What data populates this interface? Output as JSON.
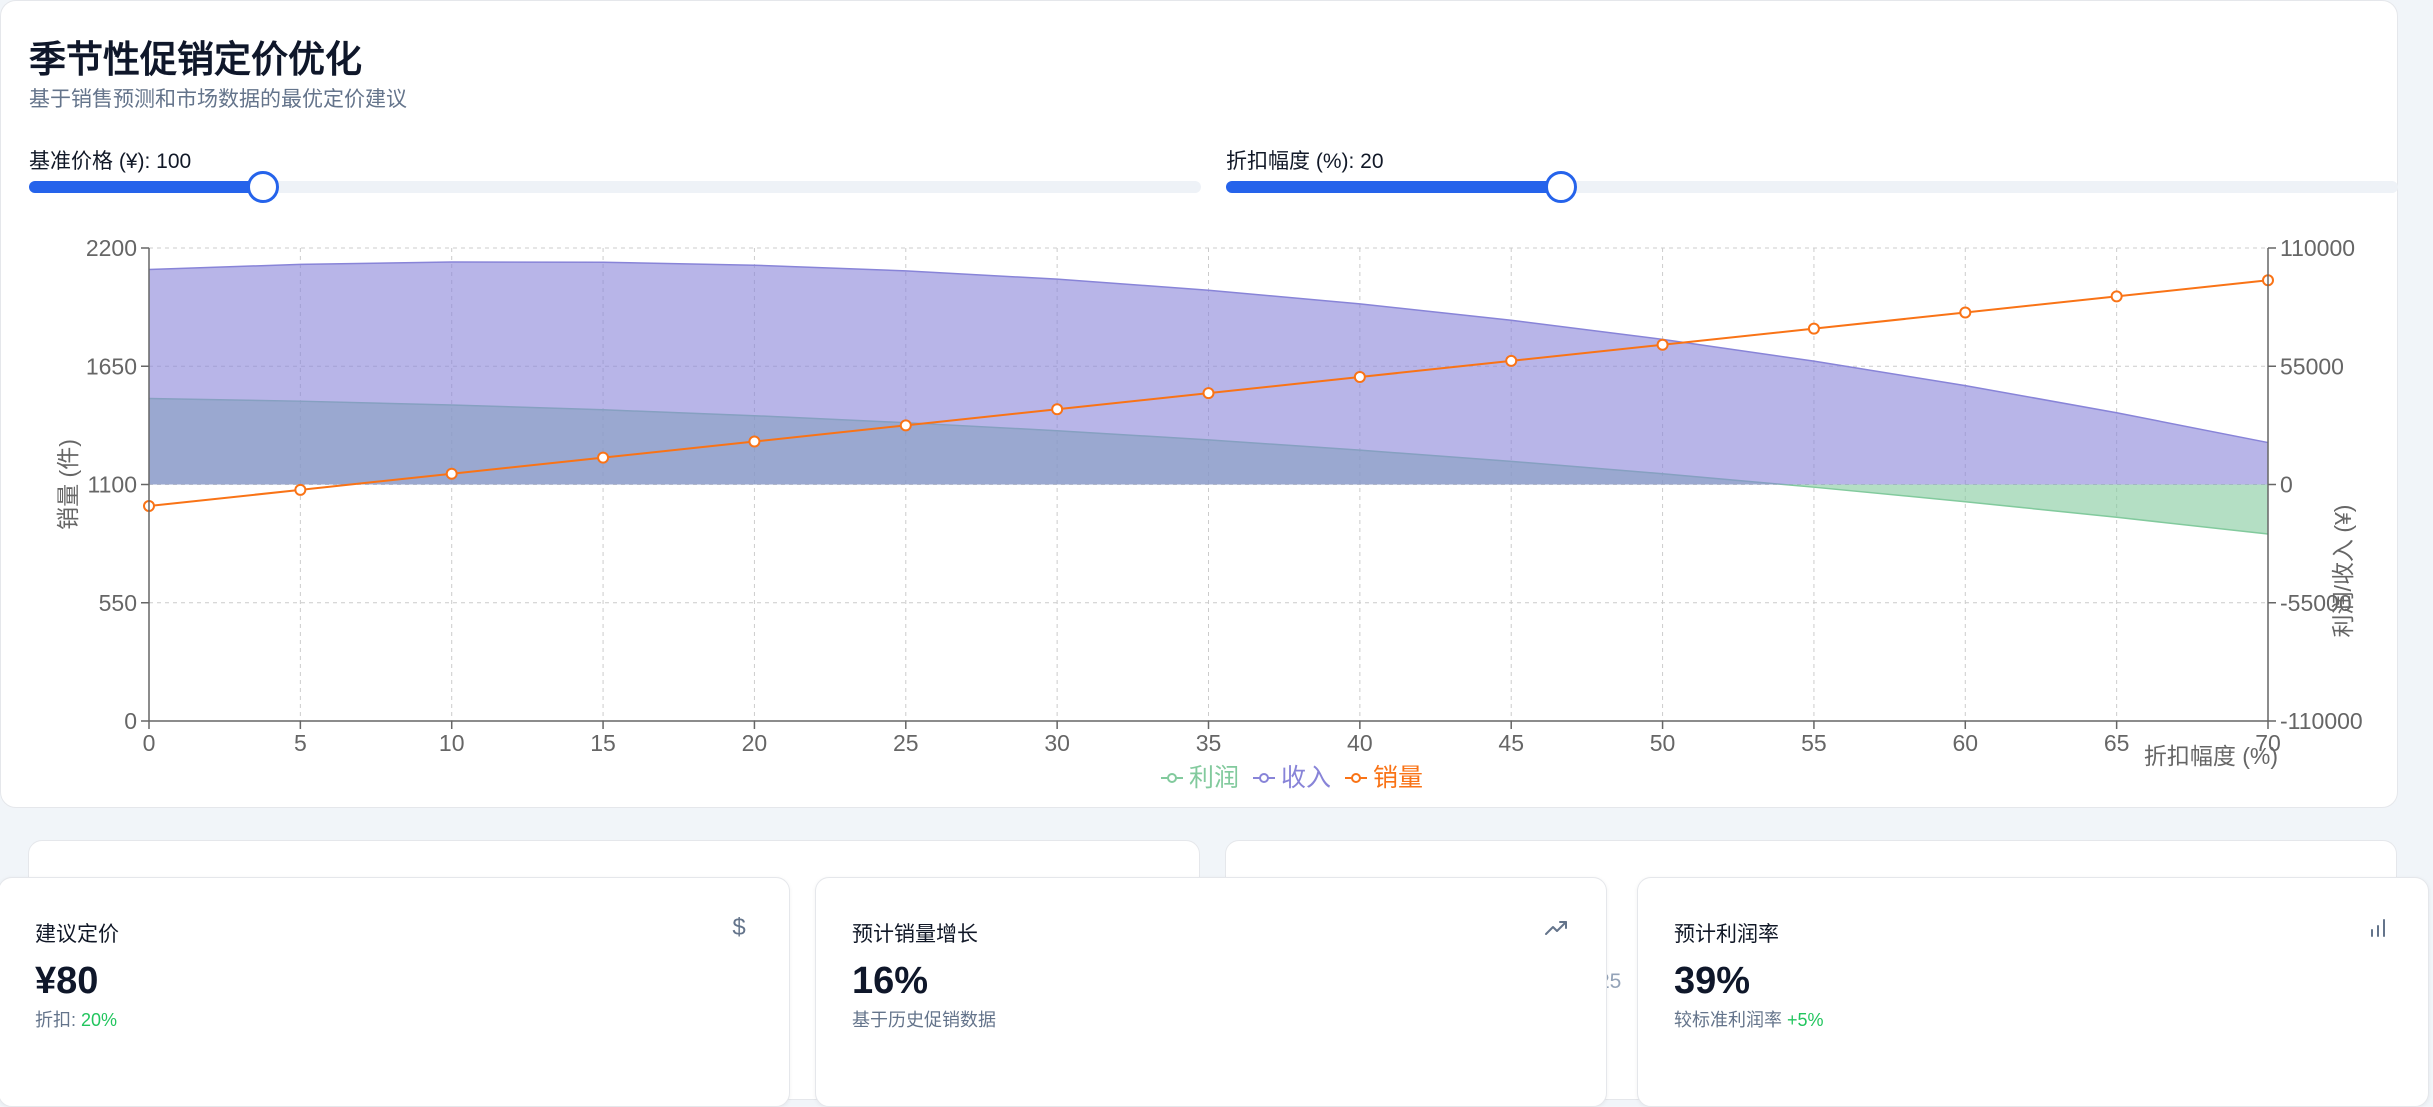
{
  "header": {
    "title": "季节性促销定价优化",
    "subtitle": "基于销售预测和市场数据的最优定价建议"
  },
  "sliders": {
    "base_price": {
      "label": "基准价格 (¥): 100",
      "value": 100,
      "min": 50,
      "max": 300
    },
    "discount": {
      "label": "折扣幅度 (%): 20",
      "value": 20,
      "min": 0,
      "max": 70
    }
  },
  "chart_data": {
    "type": "line",
    "x": [
      0,
      5,
      10,
      15,
      20,
      25,
      30,
      35,
      40,
      45,
      50,
      55,
      60,
      65,
      70
    ],
    "xlabel": "折扣幅度 (%)",
    "ylabel_left": "销量 (件)",
    "ylabel_right": "利润/收入 (¥)",
    "xlim": [
      0,
      70
    ],
    "ylim_left": [
      0,
      2200
    ],
    "ylim_right": [
      -110000,
      110000
    ],
    "yticks_left": [
      0,
      550,
      1100,
      1650,
      2200
    ],
    "yticks_right": [
      -110000,
      -55000,
      0,
      55000,
      110000
    ],
    "grid": true,
    "legend_position": "bottom",
    "series": [
      {
        "name": "利润",
        "type": "area",
        "axis": "right",
        "color": "#82ca9d",
        "values": [
          40000,
          38750,
          37000,
          34750,
          32000,
          28750,
          25000,
          20750,
          16000,
          10750,
          5000,
          -1250,
          -8000,
          -15250,
          -23000
        ],
        "show_dots": false
      },
      {
        "name": "收入",
        "type": "area",
        "axis": "right",
        "color": "#8884d8",
        "values": [
          100000,
          102375,
          103500,
          103375,
          102000,
          99375,
          95500,
          90375,
          84000,
          76375,
          67500,
          57375,
          46000,
          33375,
          19500
        ],
        "show_dots": false
      },
      {
        "name": "销量",
        "type": "line",
        "axis": "left",
        "color": "#f97316",
        "values": [
          1000,
          1075,
          1150,
          1225,
          1300,
          1375,
          1450,
          1525,
          1600,
          1675,
          1750,
          1825,
          1900,
          1975,
          2050
        ],
        "show_dots": true
      }
    ]
  },
  "stats": [
    {
      "title": "建议定价",
      "value": "¥80",
      "sub_prefix": "折扣: ",
      "sub_highlight": "20%",
      "icon": "dollar-icon"
    },
    {
      "title": "预计销量增长",
      "value": "16%",
      "sub_prefix": "基于历史促销数据",
      "sub_highlight": "",
      "icon": "trending-up-icon"
    },
    {
      "title": "预计利润率",
      "value": "39%",
      "sub_prefix": "较标准利润率 ",
      "sub_highlight": "+5%",
      "icon": "bar-chart-icon"
    }
  ],
  "background": {
    "partial_text": "25"
  },
  "colors": {
    "accent": "#2563eb",
    "positive": "#22c55e",
    "profit": "#82ca9d",
    "revenue": "#8884d8",
    "volume": "#f97316"
  }
}
